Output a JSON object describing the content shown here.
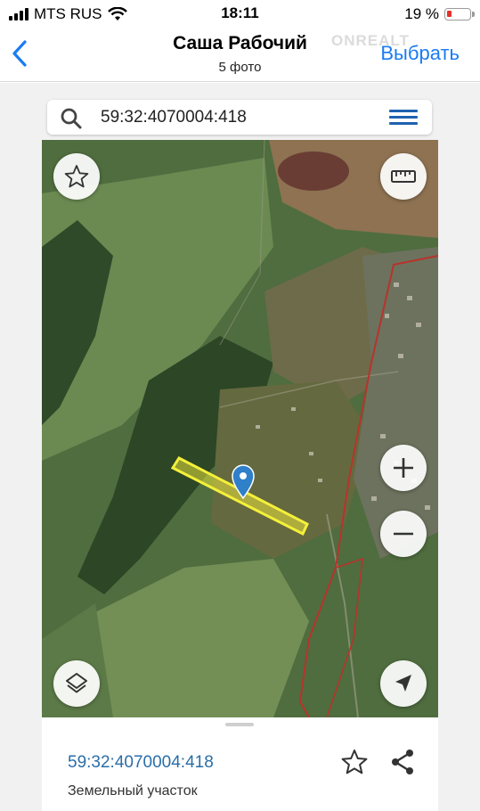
{
  "status": {
    "carrier": "MTS RUS",
    "time": "18:11",
    "battery": "19 %",
    "battery_level": 0.19
  },
  "nav": {
    "back_icon": "chevron-left-icon",
    "title": "Саша Рабочий",
    "subtitle": "5 фото",
    "action": "Выбрать",
    "watermark": "ONREALT"
  },
  "search": {
    "value": "59:32:4070004:418",
    "search_icon": "search-icon",
    "menu_icon": "hamburger-menu-icon"
  },
  "map": {
    "buttons": [
      "star-icon",
      "ruler-icon",
      "zoom-in-icon",
      "zoom-out-icon",
      "layers-icon",
      "location-arrow-icon"
    ],
    "parcel_color": "#f5f03a",
    "boundary_color": "#b8332c",
    "pin_color": "#2f7fc9"
  },
  "sheet": {
    "title": "59:32:4070004:418",
    "subtitle": "Земельный участок",
    "link_color": "#2a6ea8"
  },
  "colors": {
    "accent": "#1a7cf2"
  }
}
